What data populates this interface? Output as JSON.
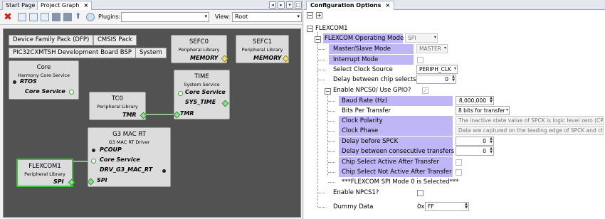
{
  "left_tabs": {
    "start_page": "Start Page",
    "project_graph": "Project Graph",
    "close": "×"
  },
  "toolbar": {
    "plugins_label": "Plugins:",
    "view_label": "View:",
    "view_value": "Root"
  },
  "graph": {
    "pills": [
      "Device Family Pack (DFP)",
      "CMSIS Pack",
      "PIC32CXMTSH Development Board BSP",
      "System"
    ],
    "core": {
      "title": "Core",
      "subtitle": "Harmony Core Service",
      "port1": "RTOS",
      "port2": "Core Service"
    },
    "sefc0": {
      "title": "SEFC0",
      "subtitle": "Peripheral Library",
      "port": "MEMORY"
    },
    "sefc1": {
      "title": "SEFC1",
      "subtitle": "Peripheral Library",
      "port": "MEMORY"
    },
    "time": {
      "title": "TIME",
      "subtitle": "System Service",
      "port1": "Core Service",
      "port2": "SYS_TIME",
      "port3": "TMR"
    },
    "tc0": {
      "title": "TC0",
      "subtitle": "Peripheral Library",
      "port": "TMR"
    },
    "g3mac": {
      "title": "G3 MAC RT",
      "subtitle": "G3 MAC RT Driver",
      "port1": "PCOUP",
      "port2": "Core Service",
      "port3": "DRV_G3_MAC_RT",
      "port4": "SPI"
    },
    "flexcom1": {
      "title": "FLEXCOM1",
      "subtitle": "Peripheral Library",
      "port": "SPI"
    }
  },
  "config": {
    "tab": "Configuration Options",
    "close": "×",
    "root": "FLEXCOM1",
    "rows": {
      "op_mode": "FLEXCOM Operating Mode",
      "op_mode_val": "SPI",
      "ms_mode": "Master/Slave Mode",
      "ms_mode_val": "MASTER",
      "int_mode": "Interrupt Mode",
      "clk_src": "Select Clock Source",
      "clk_src_val": "PERIPH_CLK",
      "dly_cs": "Delay between chip selects",
      "dly_cs_val": "0",
      "npcs0": "Enable NPCS0/ Use GPIO?",
      "baud": "Baud Rate (Hz)",
      "baud_val": "8,000,000",
      "bpt": "Bits Per Transfer",
      "bpt_val": "8 bits for transfer",
      "cpol": "Clock Polarity",
      "cpol_val": "The inactive state value of SPCK is logic level zero (CPOL=0)",
      "cpha": "Clock Phase",
      "cpha_val": "Data are captured on the leading edge of SPCK and changed on th",
      "dly_spck": "Delay before SPCK",
      "dly_spck_val": "0",
      "dly_ct": "Delay between consecutive transfers",
      "dly_ct_val": "0",
      "csaat": "Chip Select Active After Transfer",
      "csnaat": "Chip Select Not Active After Transfer",
      "note": "***FLEXCOM SPI Mode 0 is Selected***",
      "npcs1": "Enable NPCS1?",
      "dummy": "Dummy Data",
      "dummy_prefix": "0x",
      "dummy_val": "FF"
    }
  }
}
